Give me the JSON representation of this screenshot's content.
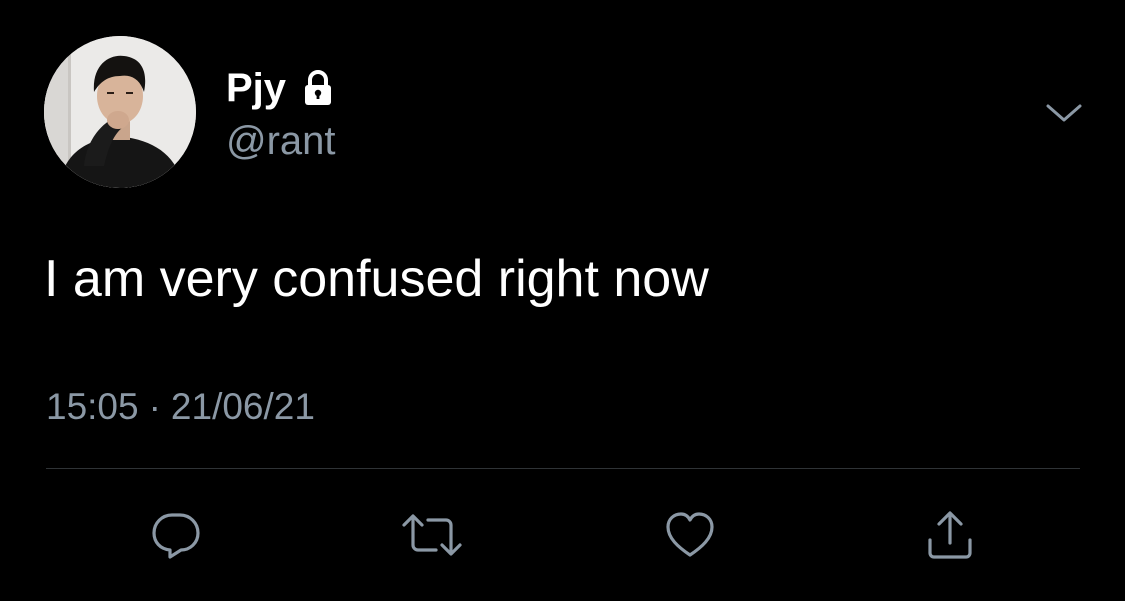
{
  "tweet": {
    "author": {
      "display_name": "Pjy",
      "handle": "@rant",
      "protected_icon": "lock-icon",
      "avatar": "profile-photo"
    },
    "menu_icon": "chevron-down-icon",
    "text": "I am very confused right now",
    "time": "15:05",
    "separator": "·",
    "date": "21/06/21"
  },
  "actions": [
    {
      "name": "reply",
      "icon": "reply-icon"
    },
    {
      "name": "retweet",
      "icon": "retweet-icon"
    },
    {
      "name": "like",
      "icon": "heart-icon"
    },
    {
      "name": "share",
      "icon": "share-icon"
    }
  ],
  "colors": {
    "background": "#000000",
    "primary_text": "#ffffff",
    "secondary_text": "#8b98a5",
    "divider": "#2f3336"
  }
}
